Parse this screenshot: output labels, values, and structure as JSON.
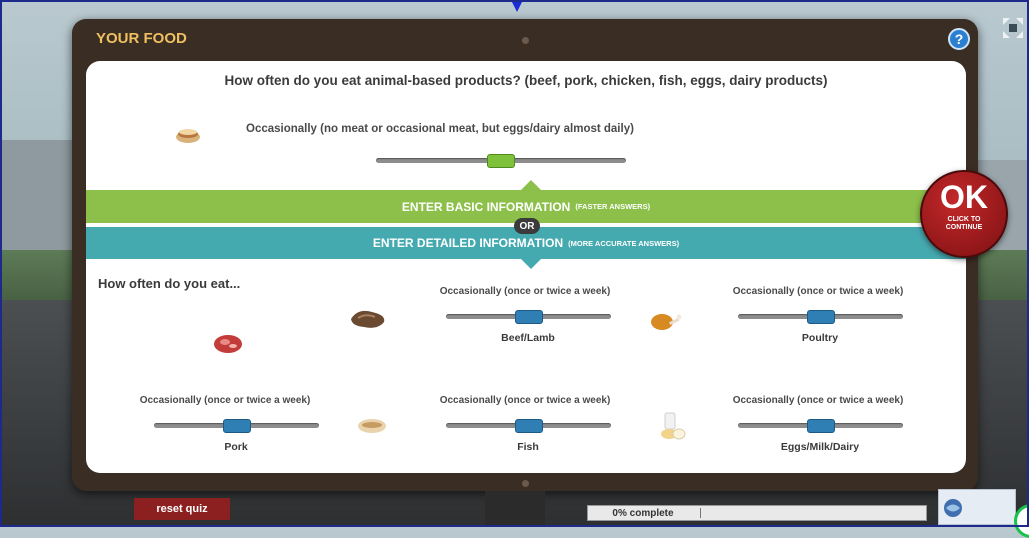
{
  "panel": {
    "title": "YOUR FOOD",
    "help_label": "?"
  },
  "top_question": {
    "text": "How often do you eat animal-based products? (beef, pork, chicken, fish, eggs, dairy products)",
    "current_value": "Occasionally (no meat or occasional meat, but eggs/dairy almost daily)",
    "slider_position": 0.5,
    "slider_color": "#7dc23a"
  },
  "bands": {
    "basic_label": "ENTER BASIC INFORMATION",
    "basic_small": "(FASTER ANSWERS)",
    "or_label": "OR",
    "detailed_label": "ENTER DETAILED INFORMATION",
    "detailed_small": "(MORE ACCURATE ANSWERS)",
    "basic_color": "#8cc04a",
    "detailed_color": "#45aab0"
  },
  "detailed": {
    "heading": "How often do you eat...",
    "categories": [
      {
        "name": "Beef/Lamb",
        "value": "Occasionally (once or twice a week)",
        "slider_position": 0.5,
        "icon": "meat-icon"
      },
      {
        "name": "Poultry",
        "value": "Occasionally (once or twice a week)",
        "slider_position": 0.5,
        "icon": "chicken-leg-icon"
      },
      {
        "name": "Pork",
        "value": "Occasionally (once or twice a week)",
        "slider_position": 0.5,
        "icon": "pork-icon"
      },
      {
        "name": "Fish",
        "value": "Occasionally (once or twice a week)",
        "slider_position": 0.5,
        "icon": "fish-icon"
      },
      {
        "name": "Eggs/Milk/Dairy",
        "value": "Occasionally (once or twice a week)",
        "slider_position": 0.5,
        "icon": "dairy-icon"
      }
    ]
  },
  "ok_button": {
    "label": "OK",
    "sub_line1": "CLICK TO",
    "sub_line2": "CONTINUE",
    "color": "#a81c1e"
  },
  "footer": {
    "reset_label": "reset quiz",
    "progress_text": "0% complete",
    "progress_fraction": 0.0
  }
}
